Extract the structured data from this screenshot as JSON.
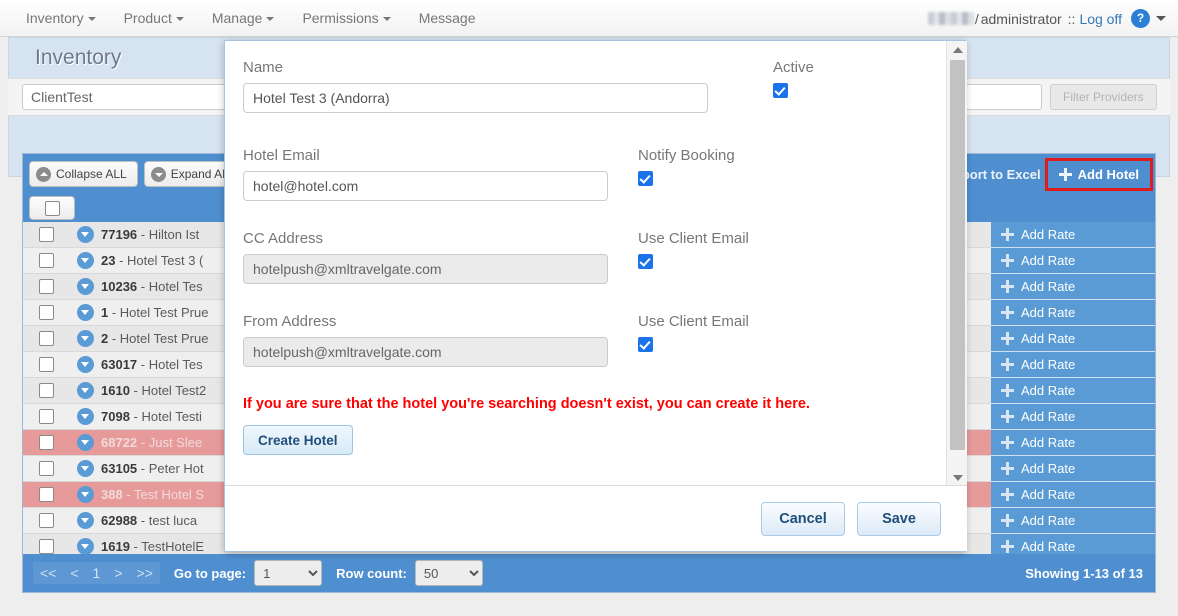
{
  "navbar": {
    "items": [
      {
        "label": "Inventory",
        "caret": true,
        "name": "nav-inventory"
      },
      {
        "label": "Product",
        "caret": true,
        "name": "nav-product"
      },
      {
        "label": "Manage",
        "caret": true,
        "name": "nav-manage"
      },
      {
        "label": "Permissions",
        "caret": true,
        "name": "nav-permissions"
      },
      {
        "label": "Message",
        "caret": false,
        "name": "nav-message"
      }
    ],
    "user_redacted": "",
    "slash": "/",
    "account": "administrator",
    "separator": "::",
    "logoff": "Log off",
    "help_icon": "?",
    "help_glyph": "question-mark-icon"
  },
  "page": {
    "title": "Inventory",
    "client_value": "ClientTest",
    "client_placeholder": "",
    "filter_providers": "Filter Providers"
  },
  "toolbar": {
    "collapse_all": "Collapse ALL",
    "expand_all": "Expand ALL",
    "export_excel": "Export to Excel",
    "add_hotel": "Add Hotel"
  },
  "grid": {
    "rows": [
      {
        "id": "77196",
        "name": "Hilton Ist",
        "flag": false
      },
      {
        "id": "23",
        "name": "Hotel Test 3 (",
        "flag": false
      },
      {
        "id": "10236",
        "name": "Hotel Tes",
        "flag": false
      },
      {
        "id": "1",
        "name": "Hotel Test Prue",
        "flag": false
      },
      {
        "id": "2",
        "name": "Hotel Test Prue",
        "flag": false
      },
      {
        "id": "63017",
        "name": "Hotel Tes",
        "flag": false
      },
      {
        "id": "1610",
        "name": "Hotel Test2",
        "flag": false
      },
      {
        "id": "7098",
        "name": "Hotel Testi",
        "flag": false
      },
      {
        "id": "68722",
        "name": "Just Slee",
        "flag": true
      },
      {
        "id": "63105",
        "name": "Peter Hot",
        "flag": false
      },
      {
        "id": "388",
        "name": "Test Hotel S",
        "flag": true
      },
      {
        "id": "62988",
        "name": "test luca",
        "flag": false
      },
      {
        "id": "1619",
        "name": "TestHotelE",
        "flag": false
      }
    ],
    "add_rate_label": "Add Rate",
    "add_rate_count": 13
  },
  "pager": {
    "first": "<<",
    "prev": "<",
    "current": "1",
    "next": ">",
    "last": ">>",
    "goto_label": "Go to page:",
    "goto_value": "1",
    "rowcount_label": "Row count:",
    "rowcount_value": "50",
    "showing": "Showing 1-13 of 13"
  },
  "modal": {
    "fields": [
      {
        "label": "Name",
        "value": "Hotel Test 3 (Andorra)",
        "disabled": false,
        "right_label": "Active",
        "right_checked": true,
        "right_centered": true,
        "input_width": 465,
        "name": "name"
      },
      {
        "label": "Hotel Email",
        "value": "hotel@hotel.com",
        "disabled": false,
        "right_label": "Notify Booking",
        "right_checked": true,
        "right_centered": false,
        "input_width": 365,
        "name": "hotel-email"
      },
      {
        "label": "CC Address",
        "value": "hotelpush@xmltravelgate.com",
        "disabled": true,
        "right_label": "Use Client Email",
        "right_checked": true,
        "right_centered": false,
        "input_width": 365,
        "name": "cc-address"
      },
      {
        "label": "From Address",
        "value": "hotelpush@xmltravelgate.com",
        "disabled": true,
        "right_label": "Use Client Email",
        "right_checked": true,
        "right_centered": false,
        "input_width": 365,
        "name": "from-address"
      }
    ],
    "warning": "If you are sure that the hotel you're searching doesn't exist, you can create it here.",
    "create_hotel": "Create Hotel",
    "cancel": "Cancel",
    "save": "Save"
  },
  "colors": {
    "accent_blue": "#4f8fd0",
    "checkbox_blue": "#1a73e8",
    "warning_red": "#ff0000",
    "flag_row": "#e79a9a",
    "highlight_outline": "#e01b1b"
  }
}
